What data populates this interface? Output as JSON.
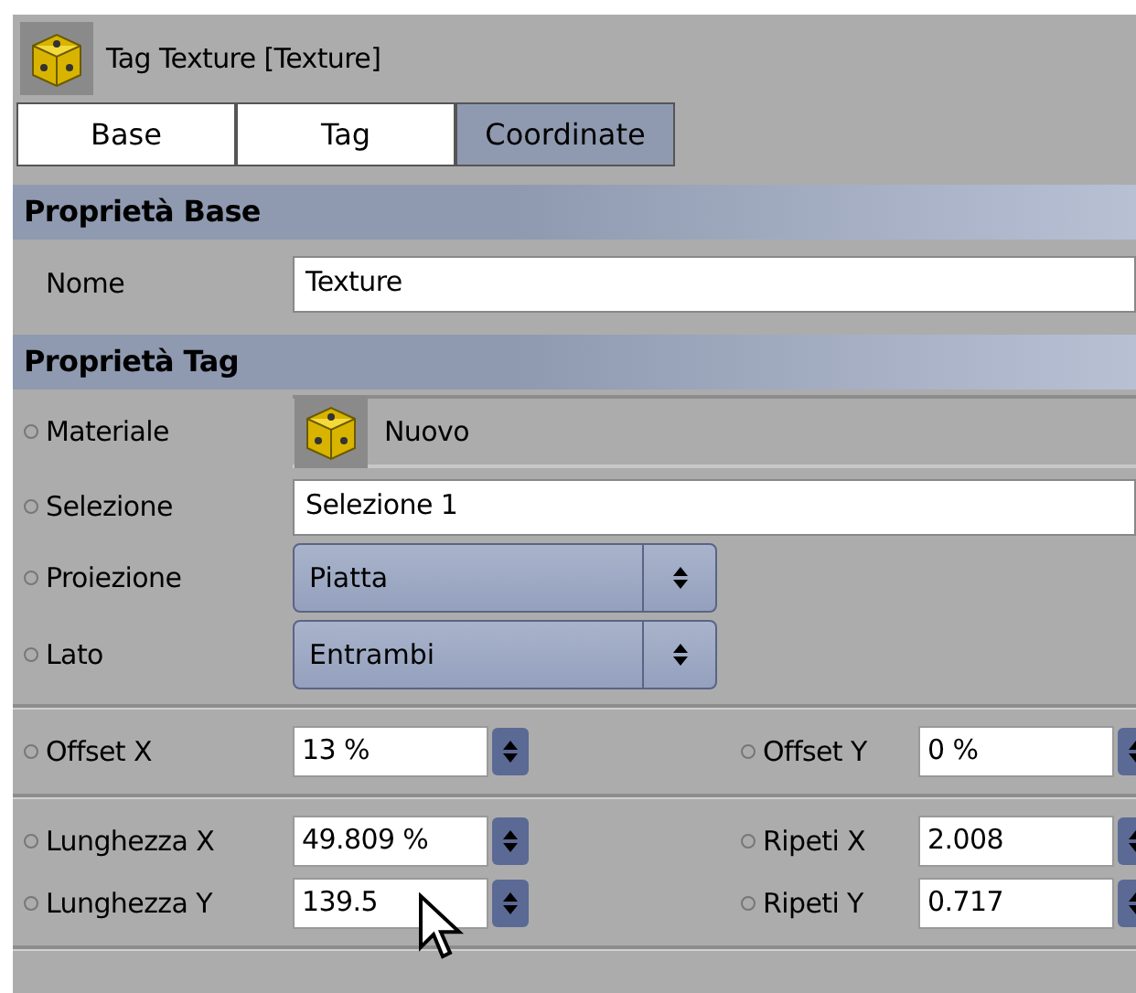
{
  "title": "Tag Texture [Texture]",
  "tabs": [
    {
      "label": "Base",
      "selected": false
    },
    {
      "label": "Tag",
      "selected": false
    },
    {
      "label": "Coordinate",
      "selected": true
    }
  ],
  "sections": [
    {
      "title": "Proprietà Base",
      "rows": [
        {
          "kind": "text",
          "label": "Nome",
          "value": "Texture",
          "keyframe_dot": false
        }
      ]
    },
    {
      "title": "Proprietà Tag",
      "rows": [
        {
          "kind": "material",
          "label": "Materiale",
          "value": "Nuovo",
          "keyframe_dot": true
        },
        {
          "kind": "text",
          "label": "Selezione",
          "value": "Selezione 1",
          "keyframe_dot": true
        },
        {
          "kind": "dropdown",
          "label": "Proiezione",
          "value": "Piatta",
          "keyframe_dot": true
        },
        {
          "kind": "dropdown",
          "label": "Lato",
          "value": "Entrambi",
          "keyframe_dot": true
        }
      ]
    }
  ],
  "number_groups": [
    [
      {
        "left": {
          "label": "Offset X",
          "value": "13 %"
        },
        "right": {
          "label": "Offset Y",
          "value": "0 %"
        }
      }
    ],
    [
      {
        "left": {
          "label": "Lunghezza X",
          "value": "49.809 %"
        },
        "right": {
          "label": "Ripeti X",
          "value": "2.008"
        }
      },
      {
        "left": {
          "label": "Lunghezza Y",
          "value": "139.5"
        },
        "right": {
          "label": "Ripeti Y",
          "value": "0.717"
        }
      }
    ]
  ]
}
